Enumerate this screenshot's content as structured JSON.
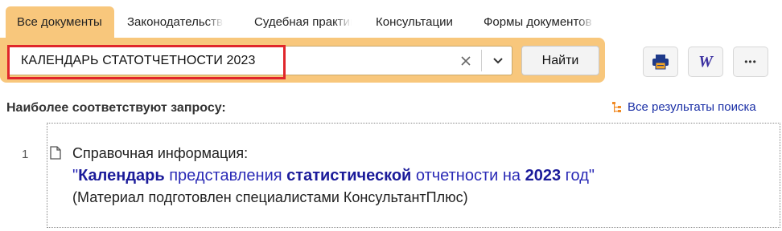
{
  "tabs": [
    {
      "label": "Все документы",
      "active": true
    },
    {
      "label": "Законодательство",
      "active": false
    },
    {
      "label": "Судебная практика",
      "active": false
    },
    {
      "label": "Консультации",
      "active": false
    },
    {
      "label": "Формы документов",
      "active": false
    }
  ],
  "search": {
    "query": "КАЛЕНДАРЬ СТАТОТЧЕТНОСТИ 2023",
    "find_label": "Найти",
    "clear_icon": "close-icon",
    "dropdown_icon": "chevron-down-icon"
  },
  "toolbar": {
    "print_icon": "printer-icon",
    "word_icon": "word-icon",
    "more_icon": "more-icon",
    "word_glyph": "W",
    "more_glyph": "•••"
  },
  "results": {
    "title": "Наиболее соответствуют запросу:",
    "all_results_label": "Все результаты поиска",
    "items": [
      {
        "number": "1",
        "line1": "Справочная информация:",
        "line2_parts": [
          {
            "text": "\"",
            "hl": false
          },
          {
            "text": "Календарь",
            "hl": true
          },
          {
            "text": " представления ",
            "hl": false
          },
          {
            "text": "статистической",
            "hl": true
          },
          {
            "text": " отчетности на ",
            "hl": false
          },
          {
            "text": "2023",
            "hl": true
          },
          {
            "text": " год\"",
            "hl": false
          }
        ],
        "line3": "(Материал подготовлен специалистами КонсультантПлюс)"
      }
    ]
  },
  "colors": {
    "band": "#f8c77c",
    "link": "#1a2fa6",
    "highlight_border": "#e0262b",
    "word_icon": "#3a2fa0"
  }
}
